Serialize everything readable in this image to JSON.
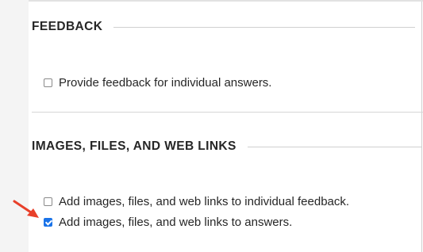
{
  "feedback_section": {
    "title": "FEEDBACK",
    "options": [
      {
        "label": "Provide feedback for individual answers.",
        "checked": false
      }
    ]
  },
  "attachments_section": {
    "title": "IMAGES, FILES, AND WEB LINKS",
    "options": [
      {
        "label": "Add images, files, and web links to individual feedback.",
        "checked": false
      },
      {
        "label": "Add images, files, and web links to answers.",
        "checked": true
      }
    ]
  },
  "annotation": {
    "arrow_icon": "red-arrow-icon",
    "arrow_color": "#e8402a"
  },
  "colors": {
    "accent": "#1a73e8"
  }
}
